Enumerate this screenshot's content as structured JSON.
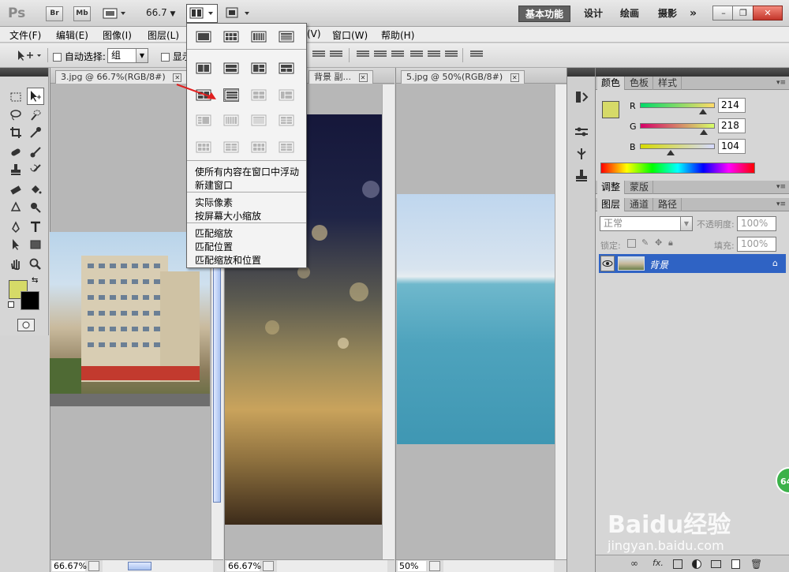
{
  "appbar": {
    "logo": "Ps",
    "bridge_label": "Br",
    "minibridge_label": "Mb",
    "zoom": "66.7",
    "workspaces": [
      "基本功能",
      "设计",
      "绘画",
      "摄影"
    ],
    "more": "»",
    "window_controls": [
      "–",
      "❐",
      "✕"
    ]
  },
  "menubar": {
    "items": [
      "文件(F)",
      "编辑(E)",
      "图像(I)",
      "图层(L)",
      "(V)",
      "窗口(W)",
      "帮助(H)"
    ]
  },
  "options": {
    "auto_select_label": "自动选择:",
    "auto_select_value": "组",
    "show_label": "显示"
  },
  "view_menu": {
    "items": [
      "使所有内容在窗口中浮动",
      "新建窗口",
      "实际像素",
      "按屏幕大小缩放",
      "匹配缩放",
      "匹配位置",
      "匹配缩放和位置"
    ]
  },
  "documents": [
    {
      "tab": "3.jpg @ 66.7%(RGB/8#)",
      "zoom": "66.67%"
    },
    {
      "tab": "背景 副...",
      "zoom": "66.67%"
    },
    {
      "tab": "5.jpg @ 50%(RGB/8#)",
      "zoom": "50%"
    }
  ],
  "color_panel": {
    "tabs": [
      "颜色",
      "色板",
      "样式"
    ],
    "r_label": "R",
    "r_value": "214",
    "g_label": "G",
    "g_value": "218",
    "b_label": "B",
    "b_value": "104",
    "fg_color": "#d6da68",
    "bg_color": "#000000"
  },
  "adjust_panel": {
    "tabs": [
      "调整",
      "蒙版"
    ]
  },
  "layers_panel": {
    "tabs": [
      "图层",
      "通道",
      "路径"
    ],
    "blend_mode": "正常",
    "opacity_label": "不透明度:",
    "opacity_value": "100%",
    "lock_label": "锁定:",
    "fill_label": "填充:",
    "fill_value": "100%",
    "layer_name": "背景",
    "bottom_icons": [
      "link-icon",
      "fx-icon",
      "mask-icon",
      "adjustment-icon",
      "folder-icon",
      "new-layer-icon",
      "trash-icon"
    ]
  },
  "watermark": {
    "brand": "Baidu经验",
    "url": "jingyan.baidu.com"
  },
  "badge": "64"
}
